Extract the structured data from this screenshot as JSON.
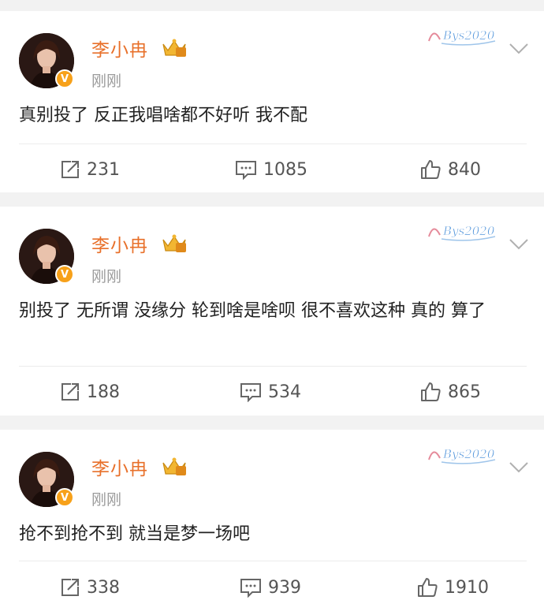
{
  "posts": [
    {
      "username": "李小冉",
      "time": "刚刚",
      "badge_text": "Bys2020",
      "content": "真别投了 反正我唱啥都不好听 我不配",
      "reposts": "231",
      "comments": "1085",
      "likes": "840"
    },
    {
      "username": "李小冉",
      "time": "刚刚",
      "badge_text": "Bys2020",
      "content": "别投了 无所谓 没缘分 轮到啥是啥呗 很不喜欢这种 真的 算了",
      "reposts": "188",
      "comments": "534",
      "likes": "865"
    },
    {
      "username": "李小冉",
      "time": "刚刚",
      "badge_text": "Bys2020",
      "content": "抢不到抢不到 就当是梦一场吧",
      "reposts": "338",
      "comments": "939",
      "likes": "1910"
    }
  ],
  "icons": {
    "repost": "repost-icon",
    "comment": "comment-icon",
    "like": "like-icon",
    "more": "chevron-down-icon",
    "verified": "verified-badge-icon",
    "member": "crown-icon"
  },
  "colors": {
    "username": "#e8702a",
    "verified": "#f7a11a",
    "badge": "#4a90d9"
  }
}
